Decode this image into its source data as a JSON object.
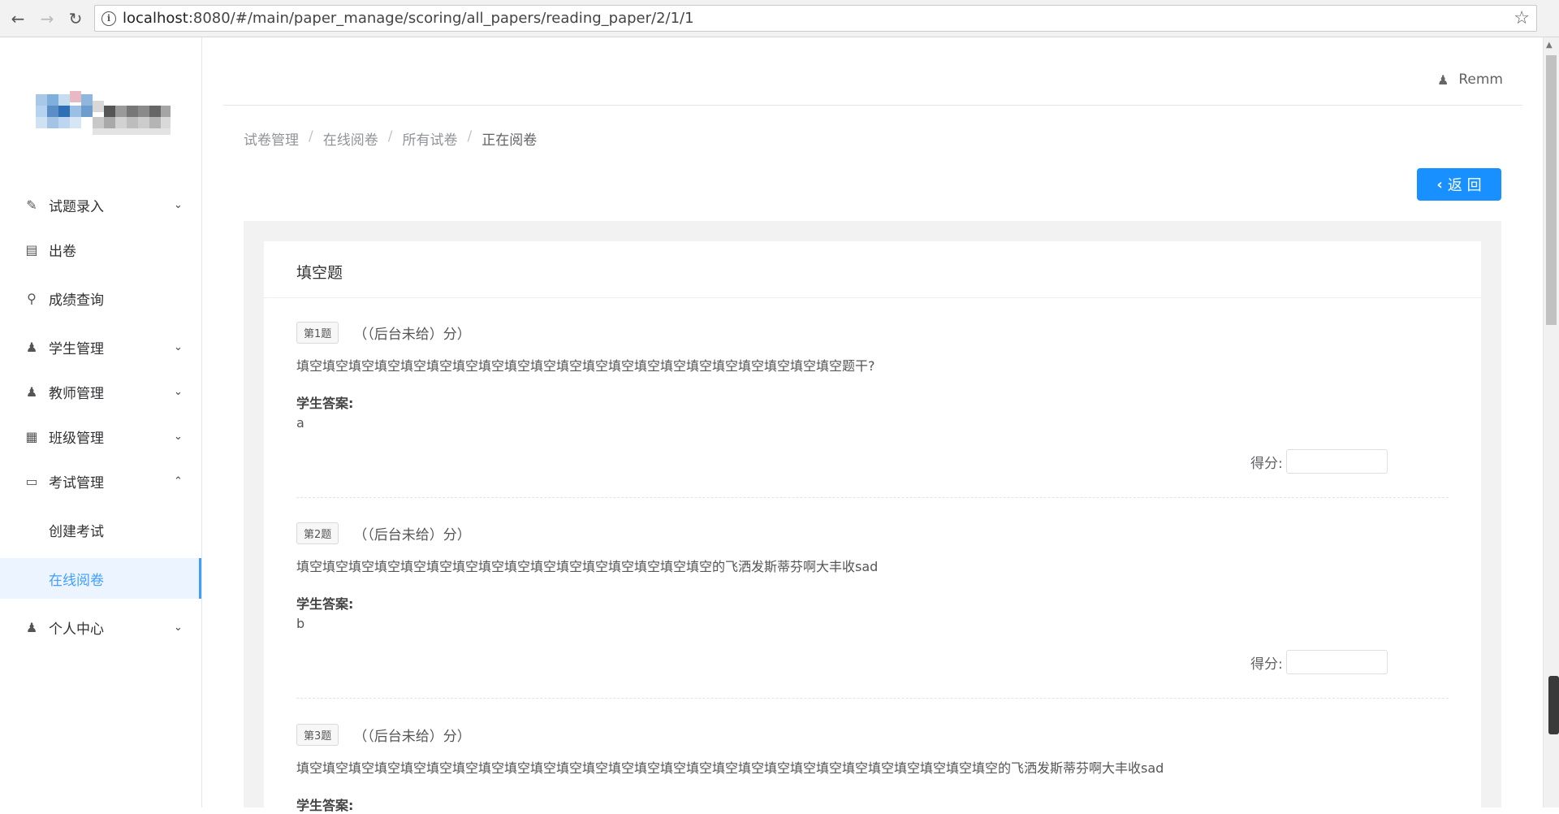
{
  "browser": {
    "url_host": "localhost",
    "url_path": ":8080/#/main/paper_manage/scoring/all_papers/reading_paper/2/1/1"
  },
  "user": {
    "name": "Remm"
  },
  "sidebar": {
    "items": [
      {
        "label": "试题录入",
        "icon": "edit-icon",
        "expand": "chevron-down"
      },
      {
        "label": "出卷",
        "icon": "list-icon",
        "expand": ""
      },
      {
        "label": "成绩查询",
        "icon": "search-icon",
        "expand": ""
      },
      {
        "label": "学生管理",
        "icon": "users-icon",
        "expand": "chevron-down"
      },
      {
        "label": "教师管理",
        "icon": "user-icon",
        "expand": "chevron-down"
      },
      {
        "label": "班级管理",
        "icon": "table-icon",
        "expand": "chevron-down"
      },
      {
        "label": "考试管理",
        "icon": "monitor-icon",
        "expand": "chevron-up"
      },
      {
        "label": "创建考试",
        "icon": "",
        "expand": ""
      },
      {
        "label": "在线阅卷",
        "icon": "",
        "expand": ""
      },
      {
        "label": "个人中心",
        "icon": "user-icon",
        "expand": "chevron-down"
      }
    ]
  },
  "breadcrumb": [
    "试卷管理",
    "在线阅卷",
    "所有试卷",
    "正在阅卷"
  ],
  "back_button": "返 回",
  "section_title": "填空题",
  "answer_label": "学生答案:",
  "grade_label": "得分:",
  "questions": [
    {
      "tag": "第1题",
      "score": "（（后台未给）分）",
      "stem": "填空填空填空填空填空填空填空填空填空填空填空填空填空填空填空填空填空填空填空填空填空题干?",
      "answer": "a"
    },
    {
      "tag": "第2题",
      "score": "（（后台未给）分）",
      "stem": "填空填空填空填空填空填空填空填空填空填空填空填空填空填空填空填空的飞洒发斯蒂芬啊大丰收sad",
      "answer": "b"
    },
    {
      "tag": "第3题",
      "score": "（（后台未给）分）",
      "stem": "填空填空填空填空填空填空填空填空填空填空填空填空填空填空填空填空填空填空填空填空填空填空填空填空填空填空填空的飞洒发斯蒂芬啊大丰收sad",
      "answer": ""
    }
  ],
  "colors": {
    "primary": "#1890ff",
    "active_menu": "#409eff"
  }
}
